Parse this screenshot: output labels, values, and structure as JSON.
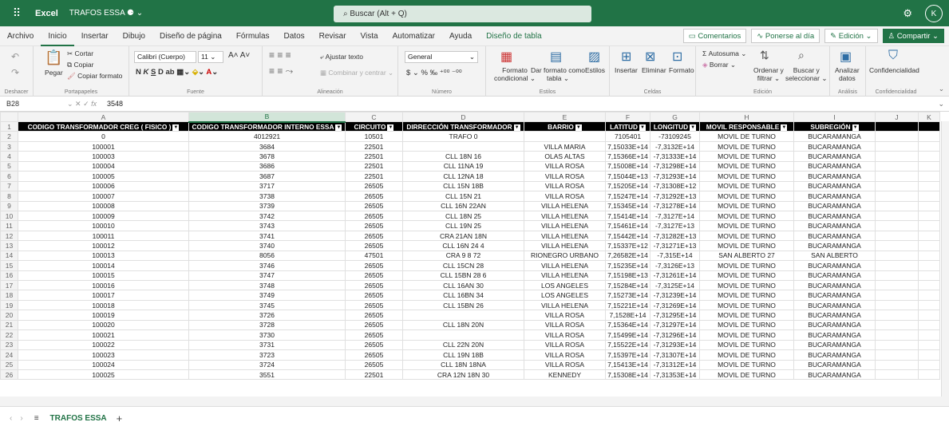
{
  "titlebar": {
    "app": "Excel",
    "doc": "TRAFOS ESSA",
    "search": "Buscar (Alt + Q)",
    "avatar": "K"
  },
  "tabs": [
    "Archivo",
    "Inicio",
    "Insertar",
    "Dibujo",
    "Diseño de página",
    "Fórmulas",
    "Datos",
    "Revisar",
    "Vista",
    "Automatizar",
    "Ayuda",
    "Diseño de tabla"
  ],
  "tabright": {
    "comments": "Comentarios",
    "catchup": "Ponerse al día",
    "editing": "Edición",
    "share": "Compartir"
  },
  "ribbon": {
    "undo_label": "Deshacer",
    "clip_label": "Portapapeles",
    "paste": "Pegar",
    "cut": "Cortar",
    "copy": "Copiar",
    "format_painter": "Copiar formato",
    "font": "Calibri (Cuerpo)",
    "size": "11",
    "font_label": "Fuente",
    "wrap": "Ajustar texto",
    "merge": "Combinar y centrar",
    "align_label": "Alineación",
    "numfmt": "General",
    "number_label": "Número",
    "cond": "Formato",
    "cond2": "condicional",
    "table": "Dar formato como",
    "table2": "tabla",
    "styles": "Estilos",
    "styles_label": "Estilos",
    "insert": "Insertar",
    "delete": "Eliminar",
    "format": "Formato",
    "cells_label": "Celdas",
    "autosum": "Autosuma",
    "clear": "Borrar",
    "sort": "Ordenar y",
    "sort2": "filtrar",
    "find": "Buscar y",
    "find2": "seleccionar",
    "edit_label": "Edición",
    "analyze": "Analizar",
    "analyze2": "datos",
    "analysis_label": "Análisis",
    "confid": "Confidencialidad",
    "confid_label": "Confidencialidad"
  },
  "formula": {
    "cell": "B28",
    "value": "3548"
  },
  "columns": [
    "A",
    "B",
    "C",
    "D",
    "E",
    "F",
    "G",
    "H",
    "I",
    "J",
    "K"
  ],
  "headers": [
    "CODIGO TRANSFORMADOR CREG ( FISICO )",
    "CODIGO TRANSFORMADOR INTERNO ESSA",
    "CIRCUITO",
    "DIRRECCIÓN TRANSFORMADOR",
    "BARRIO",
    "LATITUD",
    "LONGITUD",
    "MOVIL RESPONSABLE",
    "SUBREGIÓN"
  ],
  "rows": [
    [
      "0",
      "4012921",
      "10501",
      "TRAFO 0",
      "",
      "7105401",
      "-73109245",
      "MOVIL DE TURNO",
      "BUCARAMANGA"
    ],
    [
      "100001",
      "3684",
      "22501",
      "",
      "VILLA MARIA",
      "7,15033E+14",
      "-7,3132E+14",
      "MOVIL DE TURNO",
      "BUCARAMANGA"
    ],
    [
      "100003",
      "3678",
      "22501",
      "CLL 18N 16",
      "OLAS ALTAS",
      "7,15366E+14",
      "-7,31333E+14",
      "MOVIL DE TURNO",
      "BUCARAMANGA"
    ],
    [
      "100004",
      "3686",
      "22501",
      "CLL 11NA 19",
      "VILLA ROSA",
      "7,15008E+14",
      "-7,31298E+14",
      "MOVIL DE TURNO",
      "BUCARAMANGA"
    ],
    [
      "100005",
      "3687",
      "22501",
      "CLL 12NA 18",
      "VILLA ROSA",
      "7,15044E+13",
      "-7,31293E+14",
      "MOVIL DE TURNO",
      "BUCARAMANGA"
    ],
    [
      "100006",
      "3717",
      "26505",
      "CLL 15N 18B",
      "VILLA ROSA",
      "7,15205E+14",
      "-7,31308E+12",
      "MOVIL DE TURNO",
      "BUCARAMANGA"
    ],
    [
      "100007",
      "3738",
      "26505",
      "CLL 15N 21",
      "VILLA ROSA",
      "7,15247E+14",
      "-7,31292E+13",
      "MOVIL DE TURNO",
      "BUCARAMANGA"
    ],
    [
      "100008",
      "3739",
      "26505",
      "CLL 16N 22AN",
      "VILLA HELENA",
      "7,15345E+14",
      "-7,31278E+14",
      "MOVIL DE TURNO",
      "BUCARAMANGA"
    ],
    [
      "100009",
      "3742",
      "26505",
      "CLL 18N 25",
      "VILLA HELENA",
      "7,15414E+14",
      "-7,3127E+14",
      "MOVIL DE TURNO",
      "BUCARAMANGA"
    ],
    [
      "100010",
      "3743",
      "26505",
      "CLL 19N 25",
      "VILLA HELENA",
      "7,15461E+14",
      "-7,3127E+13",
      "MOVIL DE TURNO",
      "BUCARAMANGA"
    ],
    [
      "100011",
      "3741",
      "26505",
      "CRA 21AN 18N",
      "VILLA HELENA",
      "7,15442E+14",
      "-7,31282E+13",
      "MOVIL DE TURNO",
      "BUCARAMANGA"
    ],
    [
      "100012",
      "3740",
      "26505",
      "CLL 16N 24 4",
      "VILLA HELENA",
      "7,15337E+12",
      "-7,31271E+13",
      "MOVIL DE TURNO",
      "BUCARAMANGA"
    ],
    [
      "100013",
      "8056",
      "47501",
      "CRA 9 8 72",
      "RIONEGRO URBANO",
      "7,26582E+14",
      "-7,315E+14",
      "SAN ALBERTO 27",
      "SAN ALBERTO"
    ],
    [
      "100014",
      "3746",
      "26505",
      "CLL 15CN 28",
      "VILLA HELENA",
      "7,15235E+14",
      "-7,3126E+13",
      "MOVIL DE TURNO",
      "BUCARAMANGA"
    ],
    [
      "100015",
      "3747",
      "26505",
      "CLL 15BN 28 6",
      "VILLA HELENA",
      "7,15198E+13",
      "-7,31261E+14",
      "MOVIL DE TURNO",
      "BUCARAMANGA"
    ],
    [
      "100016",
      "3748",
      "26505",
      "CLL 16AN 30",
      "LOS ANGELES",
      "7,15284E+14",
      "-7,3125E+14",
      "MOVIL DE TURNO",
      "BUCARAMANGA"
    ],
    [
      "100017",
      "3749",
      "26505",
      "CLL 16BN 34",
      "LOS ANGELES",
      "7,15273E+14",
      "-7,31239E+14",
      "MOVIL DE TURNO",
      "BUCARAMANGA"
    ],
    [
      "100018",
      "3745",
      "26505",
      "CLL 15BN 26",
      "VILLA HELENA",
      "7,15221E+14",
      "-7,31269E+14",
      "MOVIL DE TURNO",
      "BUCARAMANGA"
    ],
    [
      "100019",
      "3726",
      "26505",
      "",
      "VILLA ROSA",
      "7,1528E+14",
      "-7,31295E+14",
      "MOVIL DE TURNO",
      "BUCARAMANGA"
    ],
    [
      "100020",
      "3728",
      "26505",
      "CLL 18N 20N",
      "VILLA ROSA",
      "7,15364E+14",
      "-7,31297E+14",
      "MOVIL DE TURNO",
      "BUCARAMANGA"
    ],
    [
      "100021",
      "3730",
      "26505",
      "",
      "VILLA ROSA",
      "7,15499E+14",
      "-7,31296E+14",
      "MOVIL DE TURNO",
      "BUCARAMANGA"
    ],
    [
      "100022",
      "3731",
      "26505",
      "CLL 22N 20N",
      "VILLA ROSA",
      "7,15522E+14",
      "-7,31293E+14",
      "MOVIL DE TURNO",
      "BUCARAMANGA"
    ],
    [
      "100023",
      "3723",
      "26505",
      "CLL 19N 18B",
      "VILLA ROSA",
      "7,15397E+14",
      "-7,31307E+14",
      "MOVIL DE TURNO",
      "BUCARAMANGA"
    ],
    [
      "100024",
      "3724",
      "26505",
      "CLL 18N 18NA",
      "VILLA ROSA",
      "7,15413E+14",
      "-7,31312E+14",
      "MOVIL DE TURNO",
      "BUCARAMANGA"
    ],
    [
      "100025",
      "3551",
      "22501",
      "CRA 12N 18N 30",
      "KENNEDY",
      "7,15308E+14",
      "-7,31353E+14",
      "MOVIL DE TURNO",
      "BUCARAMANGA"
    ]
  ],
  "sheet": "TRAFOS ESSA",
  "add_sheet": "+",
  "colors": {
    "accent": "#217346",
    "header_bg": "#000000"
  }
}
